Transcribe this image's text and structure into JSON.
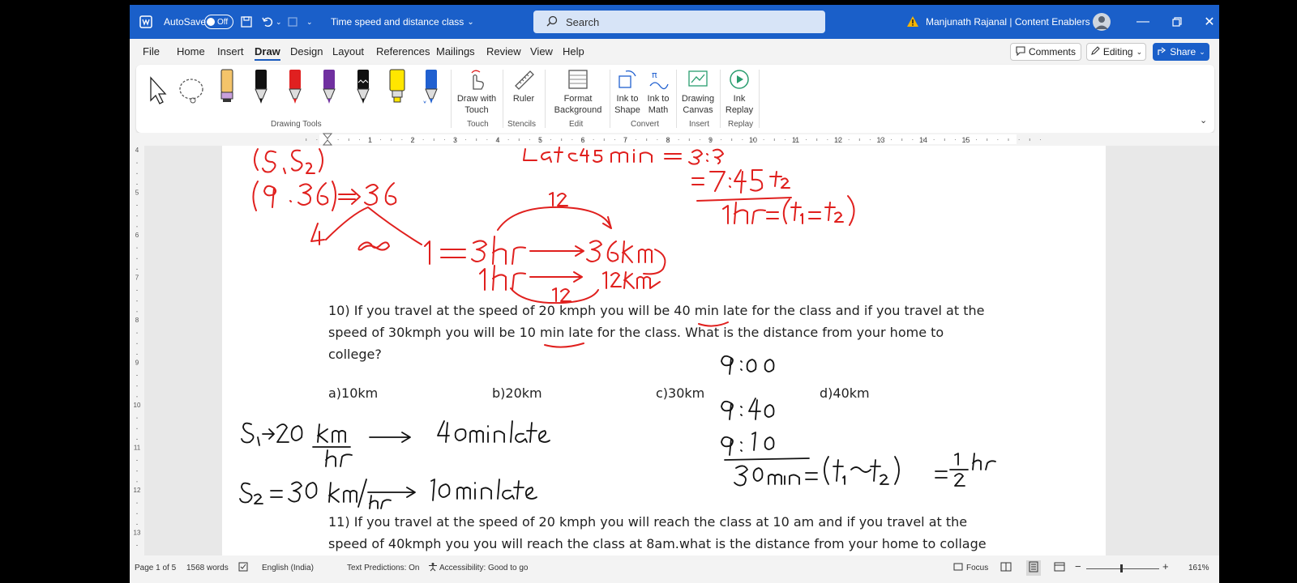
{
  "titlebar": {
    "autosave_label": "AutoSave",
    "autosave_state": "Off",
    "doc_title": "Time speed and distance class",
    "search_placeholder": "Search",
    "user": "Manjunath Rajanal | Content Enablers"
  },
  "menu": {
    "items": [
      "File",
      "Home",
      "Insert",
      "Draw",
      "Design",
      "Layout",
      "References",
      "Mailings",
      "Review",
      "View",
      "Help"
    ],
    "active": "Draw",
    "comments": "Comments",
    "editing": "Editing",
    "share": "Share"
  },
  "ribbon": {
    "group_drawing_tools": "Drawing Tools",
    "draw_with_touch": "Draw with Touch",
    "touch": "Touch",
    "ruler": "Ruler",
    "stencils": "Stencils",
    "format_background": "Format Background",
    "edit": "Edit",
    "ink_to_shape": "Ink to Shape",
    "ink_to_math": "Ink to Math",
    "convert": "Convert",
    "drawing_canvas": "Drawing Canvas",
    "insert": "Insert",
    "ink_replay": "Ink Replay",
    "replay": "Replay",
    "pen_colors": [
      "#f4c46a",
      "#111111",
      "#e02020",
      "#7030a0",
      "#111111",
      "#ffe600",
      "#2060d0"
    ]
  },
  "ruler": {
    "numbers": [
      "1",
      "2",
      "3",
      "4",
      "5",
      "6",
      "7",
      "8",
      "9",
      "10",
      "11",
      "12",
      "13",
      "14",
      "15"
    ],
    "vnumbers": [
      "4",
      "5",
      "6",
      "7",
      "8",
      "9",
      "10",
      "11",
      "12",
      "13"
    ]
  },
  "document": {
    "q10_line1": "10) If you travel at the speed of 20 kmph you will be 40 min late for the class and if you travel at the",
    "q10_line2": "speed of 30kmph you will be 10 min late for the class. What is the distance from your home to",
    "q10_line3": "college?",
    "options": [
      "a)10km",
      "b)20km",
      "c)30km",
      "d)40km"
    ],
    "q11_line1": "11) If you travel at the speed of 20 kmph you will reach the class at 10 am and if you travel at the",
    "q11_line2": "speed of 40kmph you you will reach the class at 8am.what is the distance from your home to collage"
  },
  "status": {
    "page": "Page 1 of 5",
    "words": "1568 words",
    "language": "English (India)",
    "text_predictions": "Text Predictions: On",
    "accessibility": "Accessibility: Good to go",
    "focus": "Focus",
    "zoom": "161%"
  },
  "colors": {
    "titlebar": "#1a5fc9",
    "ink_red": "#e0201e",
    "ink_black": "#111111"
  }
}
